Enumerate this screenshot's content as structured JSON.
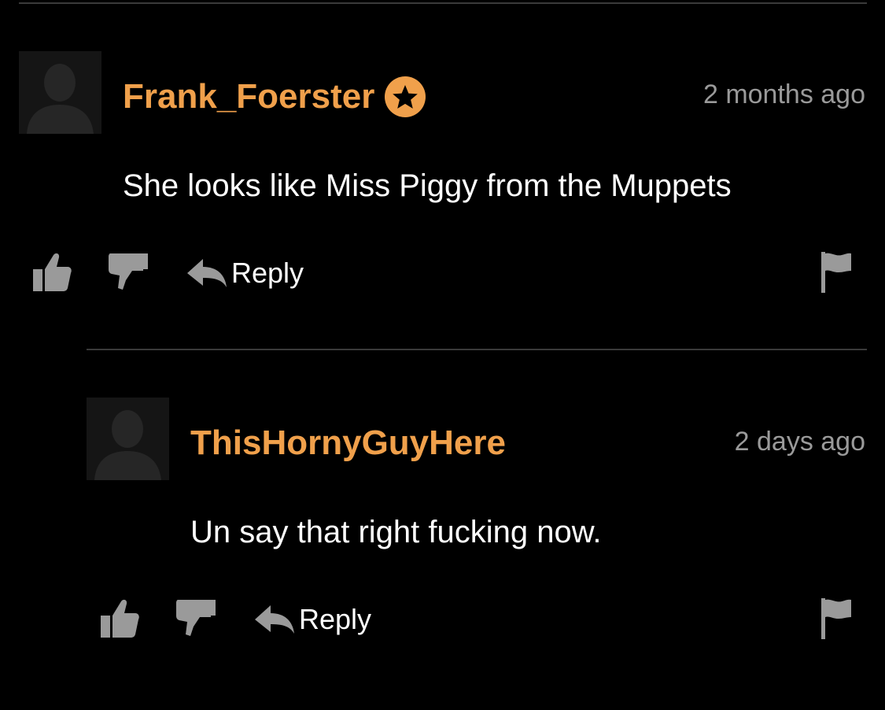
{
  "colors": {
    "background": "#000000",
    "username": "#F0A04B",
    "timestamp": "#9a9a9a",
    "comment_text": "#ffffff",
    "icon_gray": "#9a9a9a",
    "divider": "#3a3a3a"
  },
  "comments": [
    {
      "username": "Frank_Foerster",
      "badge_icon": "star-badge-icon",
      "timestamp": "2 months ago",
      "text": "She looks like Miss Piggy from the Muppets",
      "actions": {
        "upvote_icon": "thumbs-up-icon",
        "downvote_icon": "thumbs-down-icon",
        "reply_label": "Reply",
        "flag_icon": "flag-icon"
      }
    },
    {
      "username": "ThisHornyGuyHere",
      "timestamp": "2 days ago",
      "text": "Un say that right fucking now.",
      "actions": {
        "upvote_icon": "thumbs-up-icon",
        "downvote_icon": "thumbs-down-icon",
        "reply_label": "Reply",
        "flag_icon": "flag-icon"
      }
    }
  ]
}
